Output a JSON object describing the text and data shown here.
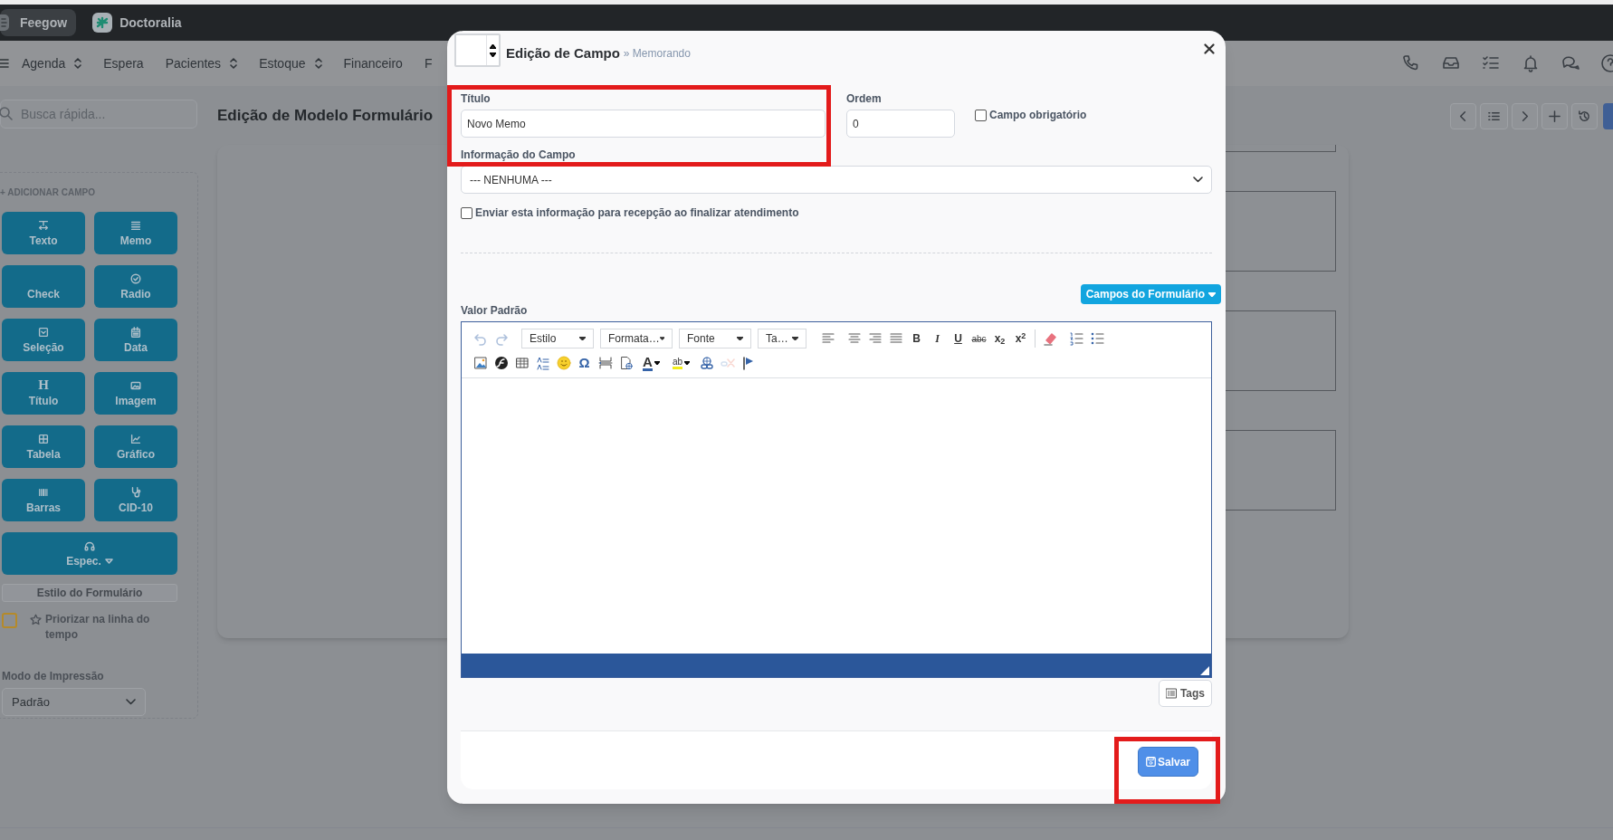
{
  "topbar": {
    "apps": [
      {
        "label": "Feegow",
        "selected": true
      },
      {
        "label": "Doctoralia",
        "selected": false
      }
    ]
  },
  "nav": {
    "items": [
      {
        "label": "Agenda",
        "dropdown": true
      },
      {
        "label": "Espera",
        "dropdown": false
      },
      {
        "label": "Pacientes",
        "dropdown": true
      },
      {
        "label": "Estoque",
        "dropdown": true
      },
      {
        "label": "Financeiro",
        "dropdown": false
      },
      {
        "label": "F",
        "dropdown": false
      }
    ]
  },
  "search": {
    "placeholder": "Busca rápida..."
  },
  "page_title": "Edição de Modelo Formulário",
  "sidebar": {
    "heading": "+ ADICIONAR CAMPO",
    "field_buttons": [
      {
        "label": "Texto"
      },
      {
        "label": "Memo"
      },
      {
        "label": "Check"
      },
      {
        "label": "Radio"
      },
      {
        "label": "Seleção"
      },
      {
        "label": "Data"
      },
      {
        "label": "Título",
        "glyph": "H"
      },
      {
        "label": "Imagem"
      },
      {
        "label": "Tabela"
      },
      {
        "label": "Gráfico"
      },
      {
        "label": "Barras"
      },
      {
        "label": "CID-10"
      },
      {
        "label": "Espec.",
        "wide": true,
        "dropdown": true
      }
    ],
    "style_button": "Estilo do Formulário",
    "prioritize": {
      "label": "Priorizar na linha do tempo",
      "checked": false
    },
    "print_mode": {
      "label": "Modo de Impressão",
      "value": "Padrão"
    }
  },
  "modal": {
    "title": "Edição de Campo",
    "breadcrumb": "» Memorando",
    "title_field": {
      "label": "Título",
      "value": "Novo Memo"
    },
    "order_field": {
      "label": "Ordem",
      "value": "0"
    },
    "required": {
      "label": "Campo obrigatório",
      "checked": false
    },
    "info_field": {
      "label": "Informação do Campo",
      "value": "--- NENHUMA ---"
    },
    "send_to_reception": {
      "label": "Enviar esta informação para recepção ao finalizar atendimento",
      "checked": false
    },
    "form_fields_button": "Campos do Formulário",
    "default_label": "Valor Padrão",
    "toolbar_rows": [
      [
        {
          "kind": "icon",
          "disabled": true
        },
        {
          "kind": "icon",
          "disabled": true
        },
        {
          "kind": "dropdown",
          "label": "Estilo"
        },
        {
          "kind": "dropdown",
          "label": "Formata…"
        },
        {
          "kind": "dropdown",
          "label": "Fonte"
        },
        {
          "kind": "dropdown",
          "label": "Ta…"
        },
        {
          "kind": "icon",
          "disabled": false
        },
        {
          "kind": "icon",
          "disabled": false
        },
        {
          "kind": "icon",
          "disabled": false
        },
        {
          "kind": "icon",
          "disabled": false
        },
        {
          "kind": "glyph",
          "label": "B"
        },
        {
          "kind": "glyph",
          "label": "I"
        },
        {
          "kind": "glyph",
          "label": "U"
        },
        {
          "kind": "glyph",
          "label": "abc"
        },
        {
          "kind": "glyph",
          "label": "x$_{2}$"
        },
        {
          "kind": "glyph",
          "label": "x$^{2}$"
        },
        {
          "kind": "icon",
          "disabled": false
        },
        {
          "kind": "icon",
          "disabled": false
        },
        {
          "kind": "icon",
          "disabled": false
        }
      ],
      [
        {
          "kind": "icon",
          "disabled": false
        },
        {
          "kind": "icon",
          "disabled": false
        },
        {
          "kind": "icon",
          "disabled": false
        },
        {
          "kind": "icon",
          "disabled": false
        },
        {
          "kind": "icon",
          "disabled": false
        },
        {
          "kind": "glyph",
          "label": "Ω"
        },
        {
          "kind": "icon",
          "disabled": false
        },
        {
          "kind": "icon",
          "disabled": false
        },
        {
          "kind": "glyph",
          "label": "A"
        },
        {
          "kind": "glyph",
          "label": "ab"
        },
        {
          "kind": "icon",
          "disabled": false
        },
        {
          "kind": "icon",
          "disabled": true
        },
        {
          "kind": "icon",
          "disabled": false
        }
      ]
    ],
    "tags_button": "Tags",
    "save_button": "Salvar"
  }
}
